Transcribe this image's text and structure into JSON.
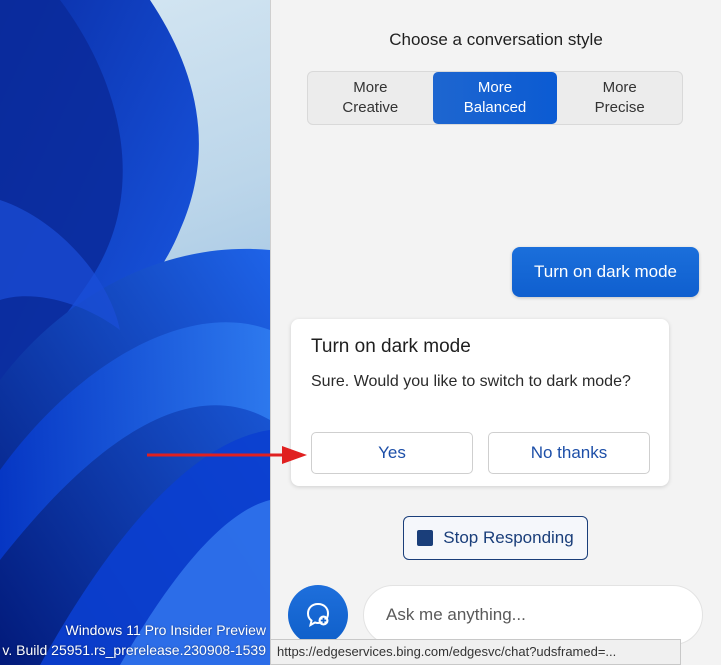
{
  "desktop": {
    "watermark_line1": "Windows 11 Pro Insider Preview",
    "watermark_line2": "v. Build 25951.rs_prerelease.230908-1539"
  },
  "copilot": {
    "style_heading": "Choose a conversation style",
    "styles": [
      {
        "line1": "More",
        "line2": "Creative",
        "selected": false
      },
      {
        "line1": "More",
        "line2": "Balanced",
        "selected": true
      },
      {
        "line1": "More",
        "line2": "Precise",
        "selected": false
      }
    ],
    "user_message": "Turn on dark mode",
    "response_card": {
      "title": "Turn on dark mode",
      "body": "Sure. Would you like to switch to dark mode?",
      "yes_label": "Yes",
      "no_label": "No thanks"
    },
    "stop_label": "Stop Responding",
    "input_placeholder": "Ask me anything...",
    "accent_color": "#0f5fcf",
    "stop_color": "#1a3e7a"
  },
  "status_bar": {
    "url": "https://edgeservices.bing.com/edgesvc/chat?udsframed=..."
  },
  "annotation": {
    "arrow_color": "#e02020"
  }
}
